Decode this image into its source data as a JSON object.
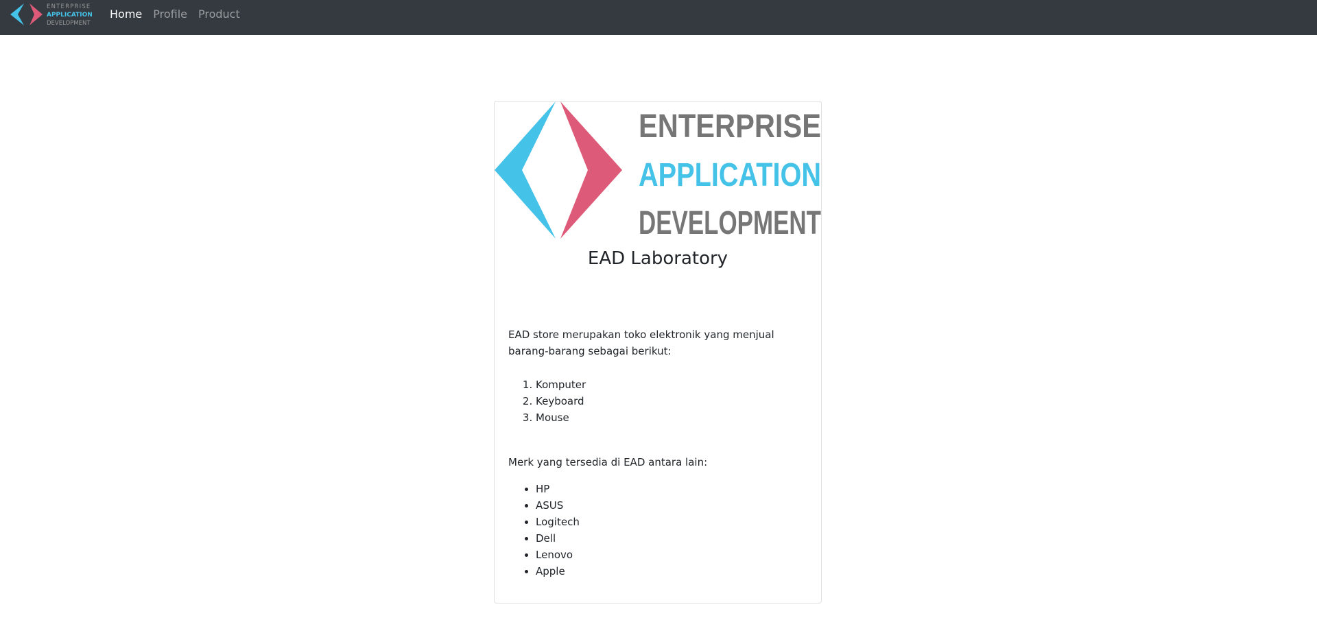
{
  "navbar": {
    "logo": {
      "line1": "ENTERPRISE",
      "line2": "APPLICATION",
      "line3": "DEVELOPMENT"
    },
    "links": [
      {
        "label": "Home",
        "active": true
      },
      {
        "label": "Profile",
        "active": false
      },
      {
        "label": "Product",
        "active": false
      }
    ]
  },
  "card": {
    "banner": {
      "line1": "ENTERPRISE",
      "line2": "APPLICATION",
      "line3": "DEVELOPMENT"
    },
    "title": "EAD Laboratory",
    "intro": "EAD store merupakan toko elektronik yang menjual barang-barang sebagai berikut:",
    "products": [
      "Komputer",
      "Keyboard",
      "Mouse"
    ],
    "brands_intro": "Merk yang tersedia di EAD antara lain:",
    "brands": [
      "HP",
      "ASUS",
      "Logitech",
      "Dell",
      "Lenovo",
      "Apple"
    ]
  },
  "colors": {
    "navbar_bg": "#343a40",
    "logo_blue": "#45c2e8",
    "logo_pink": "#dd5a78",
    "logo_gray": "#767676"
  }
}
